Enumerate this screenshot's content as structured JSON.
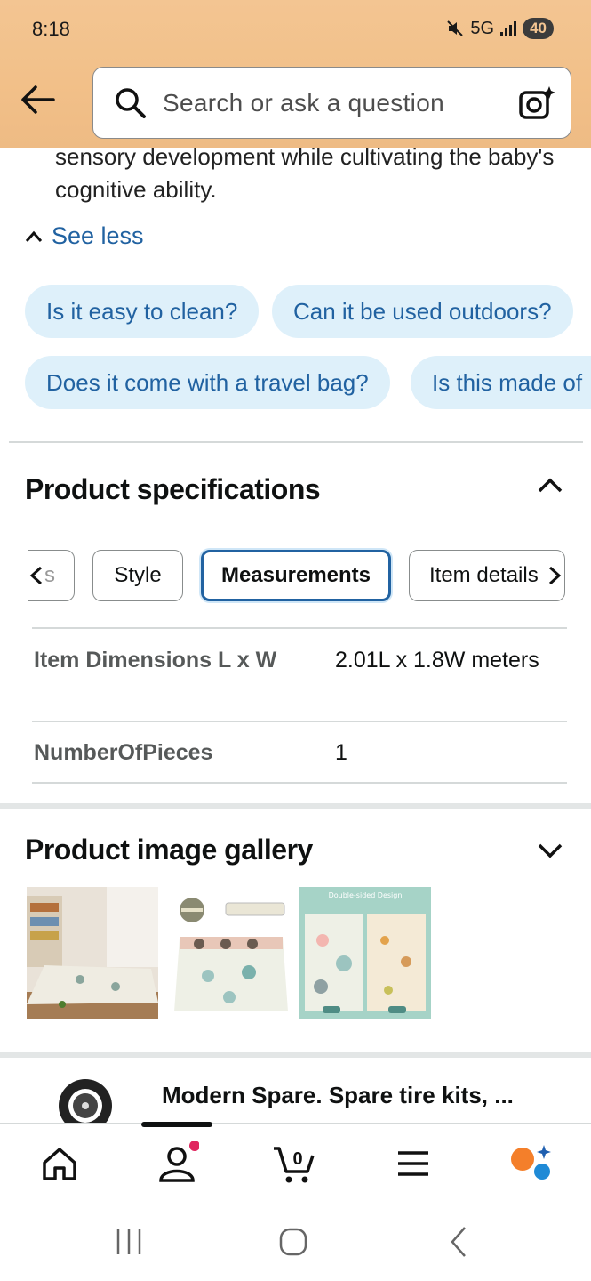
{
  "status_bar": {
    "time": "8:18",
    "network": "5G",
    "battery": "40"
  },
  "search": {
    "placeholder": "Search or ask a question"
  },
  "description": {
    "text": "sensory development while cultivating the baby's cognitive ability.",
    "see_less": "See less"
  },
  "chips": [
    "Is it easy to clean?",
    "Can it be used outdoors?",
    "Does it come with a travel bag?",
    "Is this made of"
  ],
  "specs": {
    "title": "Product specifications",
    "tabs": [
      "s",
      "Style",
      "Measurements",
      "Item details"
    ],
    "active_tab": "Measurements",
    "rows": [
      {
        "key": "Item Dimensions L x W",
        "value": "2.01L x 1.8W meters"
      },
      {
        "key": "NumberOfPieces",
        "value": "1"
      }
    ]
  },
  "gallery": {
    "title": "Product image gallery",
    "thumb3_caption": "Double-sided Design"
  },
  "ad": {
    "text": "Modern Spare. Spare tire kits, ..."
  },
  "bottom_nav": {
    "items": [
      "home",
      "account",
      "cart",
      "menu",
      "rufus"
    ],
    "cart_count": "0"
  },
  "colors": {
    "accent": "#2162a1",
    "header": "#f3c592",
    "chip_bg": "#def0fa"
  }
}
